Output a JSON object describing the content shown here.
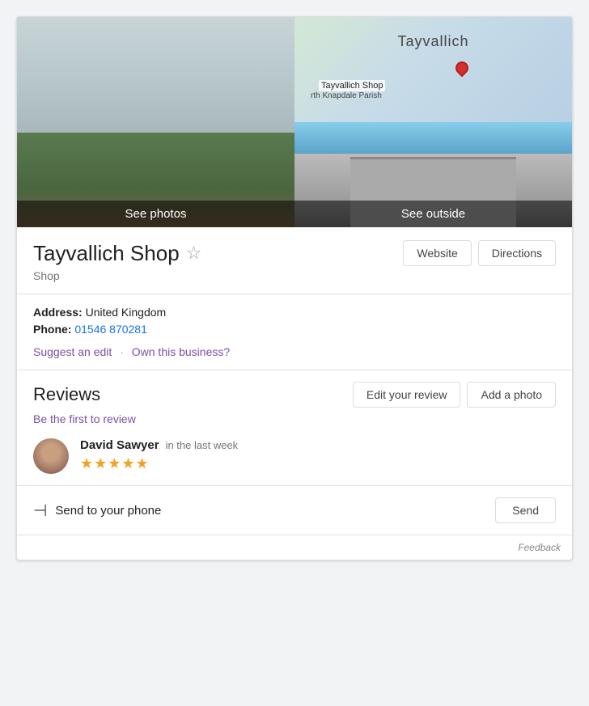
{
  "map_city_label": "Tayvallich",
  "map_shop_label": "Tayvallich Shop",
  "map_knapdale_label": "rth Knapdale Parish",
  "photos": {
    "see_photos": "See photos",
    "see_outside": "See outside"
  },
  "business": {
    "title": "Tayvallich Shop",
    "type": "Shop",
    "star_aria": "Save to favorites"
  },
  "buttons": {
    "website": "Website",
    "directions": "Directions"
  },
  "address": {
    "label": "Address:",
    "value": "United Kingdom",
    "phone_label": "Phone:",
    "phone": "01546 870281"
  },
  "links": {
    "suggest_edit": "Suggest an edit",
    "own_business": "Own this business?"
  },
  "reviews": {
    "title": "Reviews",
    "edit_review": "Edit your review",
    "add_photo": "Add a photo",
    "be_first": "Be the first to review",
    "reviewer_name": "David Sawyer",
    "reviewer_time": "in the last week",
    "stars": "★★★★★"
  },
  "send": {
    "icon": "⊣",
    "text": "Send to your phone",
    "button": "Send"
  },
  "feedback": "Feedback"
}
